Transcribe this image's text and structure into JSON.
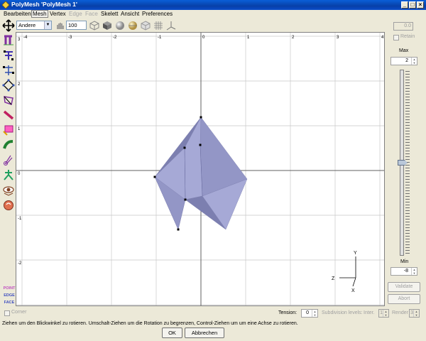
{
  "window": {
    "title": "PolyMesh 'PolyMesh 1'"
  },
  "menubar": {
    "items": [
      {
        "label": "Bearbeiten",
        "state": "normal"
      },
      {
        "label": "Mesh",
        "state": "active"
      },
      {
        "label": "Vertex",
        "state": "normal"
      },
      {
        "label": "Edge",
        "state": "disabled"
      },
      {
        "label": "Face",
        "state": "disabled"
      },
      {
        "label": "Skelett",
        "state": "normal"
      },
      {
        "label": "Ansicht",
        "state": "normal"
      },
      {
        "label": "Preferences",
        "state": "normal"
      }
    ]
  },
  "toolbar": {
    "view_select": "Andere",
    "zoom_value": "100",
    "icons": [
      "move-view-icon",
      "fit-view-icon",
      "wireframe-cube-icon",
      "shaded-cube-icon",
      "smooth-sphere-icon",
      "textured-sphere-icon",
      "transparent-cube-icon",
      "grid-icon",
      "axes-icon"
    ]
  },
  "left_tools": {
    "icons": [
      "move-icon",
      "bevel-icon",
      "scale-icon",
      "rotate-icon",
      "skew-icon",
      "taper-icon",
      "pencil-icon",
      "eraser-icon",
      "paint-icon",
      "brush-icon",
      "skeleton-icon",
      "view-eye-icon",
      "camera-hand-icon"
    ],
    "modes": [
      "POINT",
      "EDGE",
      "FACE"
    ]
  },
  "viewport": {
    "x_ticks": [
      "-4",
      "-3",
      "-2",
      "-1",
      "0",
      "1",
      "2",
      "3",
      "4"
    ],
    "y_ticks": [
      "3",
      "2",
      "1",
      "0",
      "-1",
      "-2",
      "-3"
    ],
    "axis_labels": {
      "y": "Y",
      "z": "Z",
      "x": "X"
    },
    "colors": {
      "mesh_light": "#a6a9d6",
      "mesh_mid": "#9396c6",
      "mesh_dark": "#7c7fb0",
      "grid": "#c8c8c8",
      "axis": "#606060"
    }
  },
  "right_panel": {
    "value_field": "0.0",
    "retain_label": "Retain",
    "max_label": "Max",
    "max_value": "2",
    "min_label": "Min",
    "min_value": "-8",
    "slider_level": 0.5,
    "validate_label": "Validate",
    "abort_label": "Abort"
  },
  "bottom": {
    "corner_label": "Corner",
    "tension_label": "Tension:",
    "tension_value": "0",
    "subdiv_label": "Subdivision levels:",
    "inter_label": "Inter.",
    "inter_value": "1",
    "render_label": "Render",
    "render_value": "3",
    "status_text": "Ziehen um den Blickwinkel zu rotieren. Umschalt-Ziehen um die Rotation zu begrenzen, Control-Ziehen um um eine Achse zu rotieren.",
    "ok_label": "OK",
    "cancel_label": "Abbrechen"
  }
}
